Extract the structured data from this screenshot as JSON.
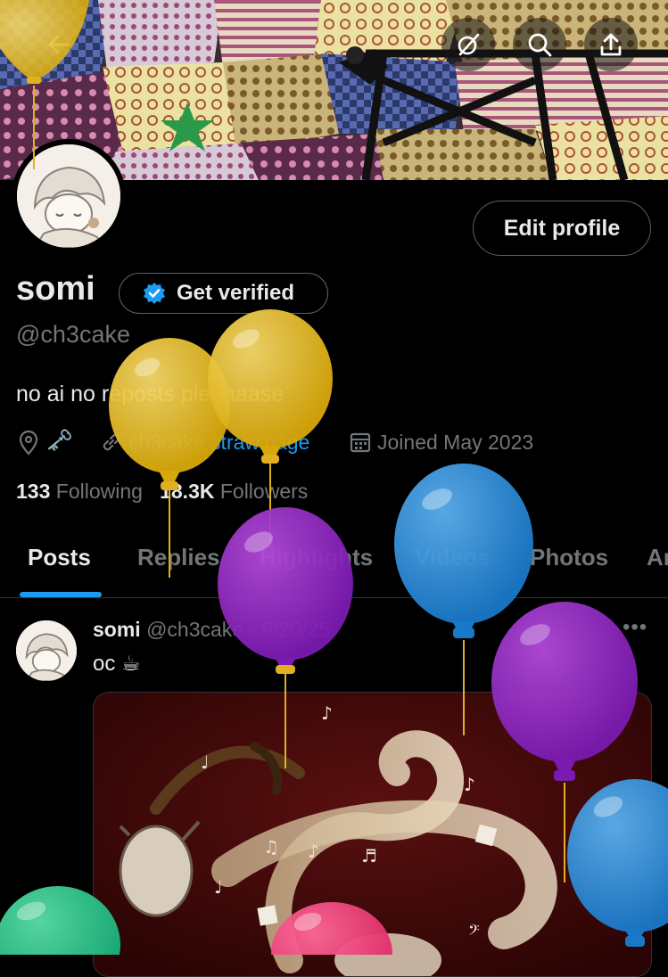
{
  "header": {
    "back_icon": "back-arrow-icon",
    "actions": [
      "grok-icon",
      "search-icon",
      "share-icon"
    ]
  },
  "profile": {
    "name": "somi",
    "verify_label": "Get verified",
    "handle": "@ch3cake",
    "bio": "no ai no reposts pleaaaase",
    "key_emoji": "🗝️",
    "link": "ch3cake.straw.page",
    "joined": "Joined May 2023",
    "following_count": "133",
    "following_label": "Following",
    "followers_count": "18.3K",
    "followers_label": "Followers",
    "edit_label": "Edit profile"
  },
  "tabs": [
    "Posts",
    "Replies",
    "Highlights",
    "Videos",
    "Photos",
    "Articles"
  ],
  "post": {
    "name": "somi",
    "handle": "@ch3cake",
    "dot": "·",
    "date": "9/20/25",
    "more": "•••",
    "text": "oc ☕"
  },
  "colors": {
    "accent": "#1d9bf0",
    "muted": "#71767b",
    "text": "#e7e9ea",
    "border": "#2f3336",
    "background": "#000000"
  }
}
